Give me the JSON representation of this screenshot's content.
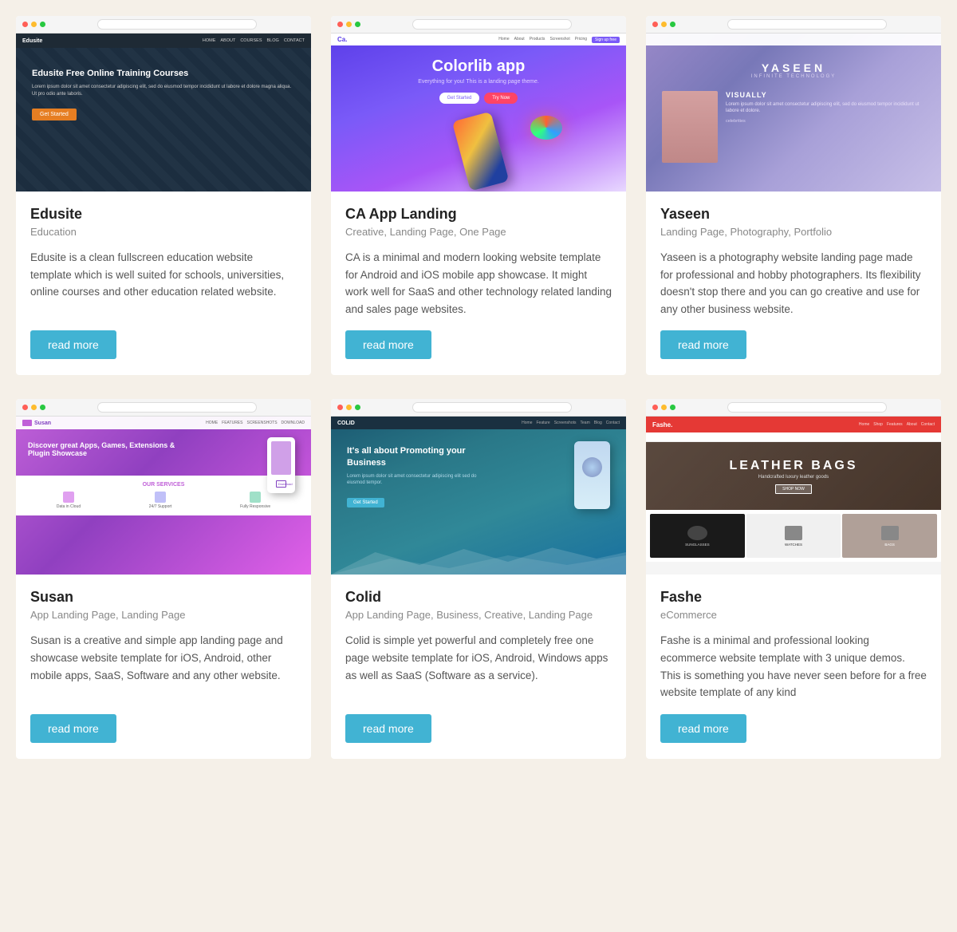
{
  "cards": [
    {
      "id": "edusite",
      "title": "Edusite",
      "tags": "Education",
      "description": "Edusite is a clean fullscreen education website template which is well suited for schools, universities, online courses and other education related website.",
      "read_more": "read more",
      "screenshot_type": "edusite"
    },
    {
      "id": "ca-app",
      "title": "CA App Landing",
      "tags": "Creative, Landing Page, One Page",
      "description": "CA is a minimal and modern looking website template for Android and iOS mobile app showcase. It might work well for SaaS and other technology related landing and sales page websites.",
      "read_more": "read more",
      "screenshot_type": "ca"
    },
    {
      "id": "yaseen",
      "title": "Yaseen",
      "tags": "Landing Page, Photography, Portfolio",
      "description": "Yaseen is a photography website landing page made for professional and hobby photographers. Its flexibility doesn't stop there and you can go creative and use for any other business website.",
      "read_more": "read more",
      "screenshot_type": "yaseen"
    },
    {
      "id": "susan",
      "title": "Susan",
      "tags": "App Landing Page, Landing Page",
      "description": "Susan is a creative and simple app landing page and showcase website template for iOS, Android, other mobile apps, SaaS, Software and any other website.",
      "read_more": "read more",
      "screenshot_type": "susan"
    },
    {
      "id": "colid",
      "title": "Colid",
      "tags": "App Landing Page, Business, Creative, Landing Page",
      "description": "Colid is simple yet powerful and completely free one page website template for iOS, Android, Windows apps as well as SaaS (Software as a service).",
      "read_more": "read more",
      "screenshot_type": "colid"
    },
    {
      "id": "fashe",
      "title": "Fashe",
      "tags": "eCommerce",
      "description": "Fashe is a minimal and professional looking ecommerce website template with 3 unique demos. This is something you have never seen before for a free website template of any kind",
      "read_more": "read more",
      "screenshot_type": "fashe"
    }
  ],
  "colors": {
    "read_more_bg": "#41b3d3",
    "page_bg": "#f5f0e8"
  }
}
